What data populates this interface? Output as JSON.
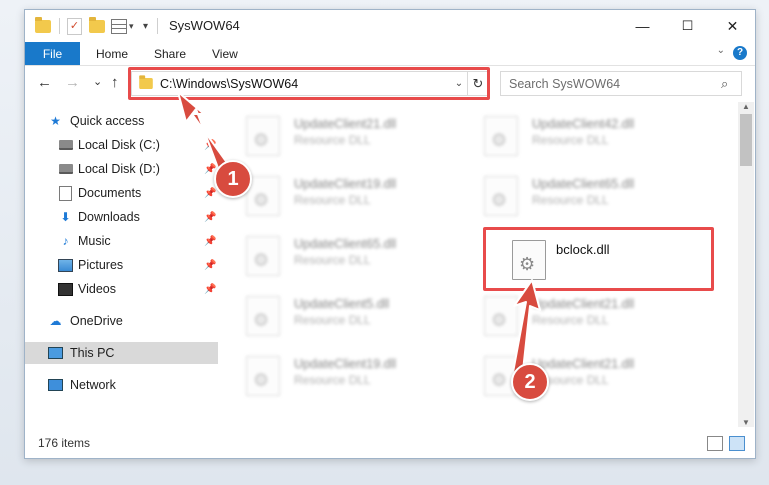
{
  "window": {
    "title": "SysWOW64",
    "controls": {
      "minimize": "—",
      "maximize": "☐",
      "close": "✕"
    }
  },
  "ribbon": {
    "tabs": [
      "File",
      "Home",
      "Share",
      "View"
    ],
    "help": "?"
  },
  "nav": {
    "back": "←",
    "forward": "→",
    "recent": "⌄",
    "up": "↑",
    "address": "C:\\Windows\\SysWOW64",
    "refresh": "↻",
    "search_placeholder": "Search SysWOW64",
    "search_icon": "⌕"
  },
  "sidebar": {
    "items": [
      {
        "label": "Quick access",
        "icon": "star-icon"
      },
      {
        "label": "Local Disk (C:)",
        "icon": "drive-icon",
        "pinned": true
      },
      {
        "label": "Local Disk (D:)",
        "icon": "drive-icon",
        "pinned": true
      },
      {
        "label": "Documents",
        "icon": "documents-icon",
        "pinned": true
      },
      {
        "label": "Downloads",
        "icon": "download-icon",
        "pinned": true
      },
      {
        "label": "Music",
        "icon": "music-icon",
        "pinned": true
      },
      {
        "label": "Pictures",
        "icon": "pictures-icon",
        "pinned": true
      },
      {
        "label": "Videos",
        "icon": "videos-icon",
        "pinned": true
      },
      {
        "label": "OneDrive",
        "icon": "cloud-icon"
      },
      {
        "label": "This PC",
        "icon": "computer-icon",
        "selected": true
      },
      {
        "label": "Network",
        "icon": "network-icon"
      }
    ],
    "pin_glyph": "📌"
  },
  "files": [
    {
      "name": "UpdateClient21.dll",
      "type": "Resource DLL"
    },
    {
      "name": "UpdateClient42.dll",
      "type": "Resource DLL"
    },
    {
      "name": "UpdateClient19.dll",
      "type": "Resource DLL"
    },
    {
      "name": "UpdateClient65.dll",
      "type": "Resource DLL"
    },
    {
      "name": "UpdateClient65.dll",
      "type": "Resource DLL"
    },
    {
      "name": "bclock.dll",
      "type": ""
    },
    {
      "name": "UpdateClient5.dll",
      "type": "Resource DLL"
    },
    {
      "name": "UpdateClient21.dll",
      "type": "Resource DLL"
    },
    {
      "name": "UpdateClient19.dll",
      "type": "Resource DLL"
    },
    {
      "name": "UpdateClient21.dll",
      "type": "Resource DLL"
    }
  ],
  "status": {
    "item_count": "176 items"
  },
  "annotations": {
    "step1": "1",
    "step2": "2",
    "highlight_color": "#e84b4b"
  }
}
